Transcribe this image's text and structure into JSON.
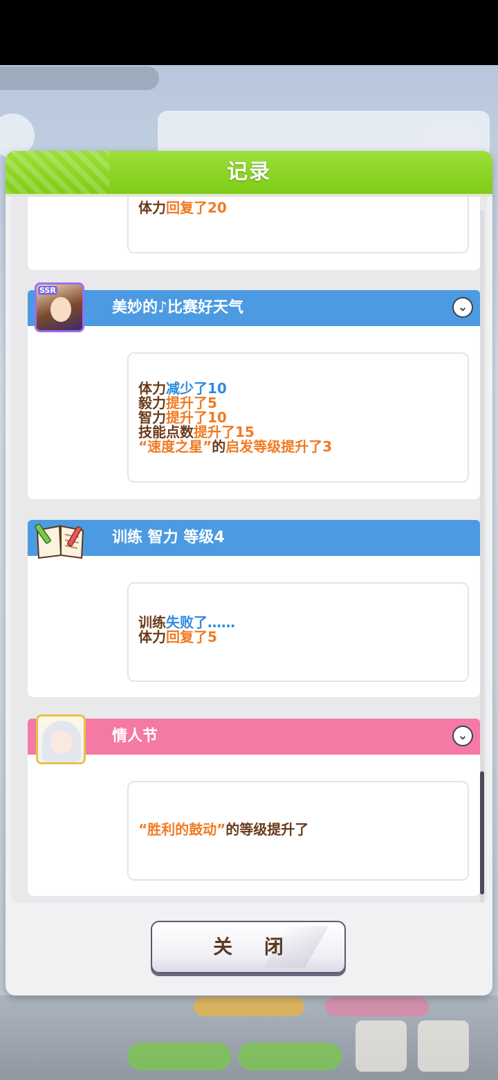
{
  "dialog": {
    "title": "记录",
    "close_label": "关 闭"
  },
  "colors": {
    "header_green": "#86d21f",
    "card_blue": "#4c9be2",
    "card_pink": "#f47aa5",
    "text_brown": "#6b3a1b",
    "text_orange": "#f07a22",
    "text_blue": "#2f8be0"
  },
  "entries": [
    {
      "lines": [
        [
          {
            "text": "体力",
            "color": "brown"
          },
          {
            "text": "回复了20",
            "color": "orange"
          }
        ]
      ]
    },
    {
      "title": "美妙的♪比赛好天气",
      "header_color": "blue",
      "icon": "support-card-portrait",
      "badge": "SSR",
      "collapsible": true,
      "lines": [
        [
          {
            "text": "体力",
            "color": "brown"
          },
          {
            "text": "减少了10",
            "color": "blue"
          }
        ],
        [
          {
            "text": "毅力",
            "color": "brown"
          },
          {
            "text": "提升了5",
            "color": "orange"
          }
        ],
        [
          {
            "text": "智力",
            "color": "brown"
          },
          {
            "text": "提升了10",
            "color": "orange"
          }
        ],
        [
          {
            "text": "技能点数",
            "color": "brown"
          },
          {
            "text": "提升了15",
            "color": "orange"
          }
        ],
        [
          {
            "text": "“速度之星”",
            "color": "orange"
          },
          {
            "text": "的",
            "color": "brown"
          },
          {
            "text": "启发等级提升了3",
            "color": "orange"
          }
        ]
      ]
    },
    {
      "title": "训练 智力 等级4",
      "header_color": "blue",
      "icon": "training-book-icon",
      "collapsible": false,
      "lines": [
        [
          {
            "text": "训练",
            "color": "brown"
          },
          {
            "text": "失败了……",
            "color": "blue"
          }
        ],
        [
          {
            "text": "体力",
            "color": "brown"
          },
          {
            "text": "回复了5",
            "color": "orange"
          }
        ]
      ]
    },
    {
      "title": "情人节",
      "header_color": "pink",
      "icon": "character-portrait",
      "collapsible": true,
      "lines": [
        [
          {
            "text": "“胜利的鼓动”",
            "color": "orange"
          },
          {
            "text": "的等级提升了",
            "color": "brown"
          }
        ]
      ]
    }
  ]
}
